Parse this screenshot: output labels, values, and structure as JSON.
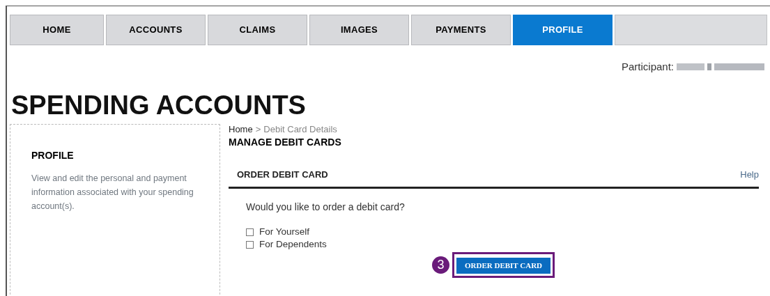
{
  "nav_tabs": [
    {
      "label": "HOME",
      "selected": false
    },
    {
      "label": "ACCOUNTS",
      "selected": false
    },
    {
      "label": "CLAIMS",
      "selected": false
    },
    {
      "label": "IMAGES",
      "selected": false
    },
    {
      "label": "PAYMENTS",
      "selected": false
    },
    {
      "label": "PROFILE",
      "selected": true
    }
  ],
  "participant": {
    "label": "Participant:"
  },
  "page_title": "SPENDING ACCOUNTS",
  "sidebar": {
    "title": "PROFILE",
    "description": "View and edit the personal and payment information associated with your spending account(s)."
  },
  "breadcrumb": {
    "home": "Home",
    "separator": ">",
    "current": "Debit Card Details"
  },
  "heading": "MANAGE DEBIT CARDS",
  "section": {
    "title": "ORDER DEBIT CARD",
    "help": "Help",
    "question": "Would you like to order a debit card?",
    "options": [
      {
        "label": "For Yourself",
        "checked": false
      },
      {
        "label": "For Dependents",
        "checked": false
      }
    ],
    "button": "ORDER DEBIT CARD"
  },
  "callout": {
    "number": "3"
  }
}
